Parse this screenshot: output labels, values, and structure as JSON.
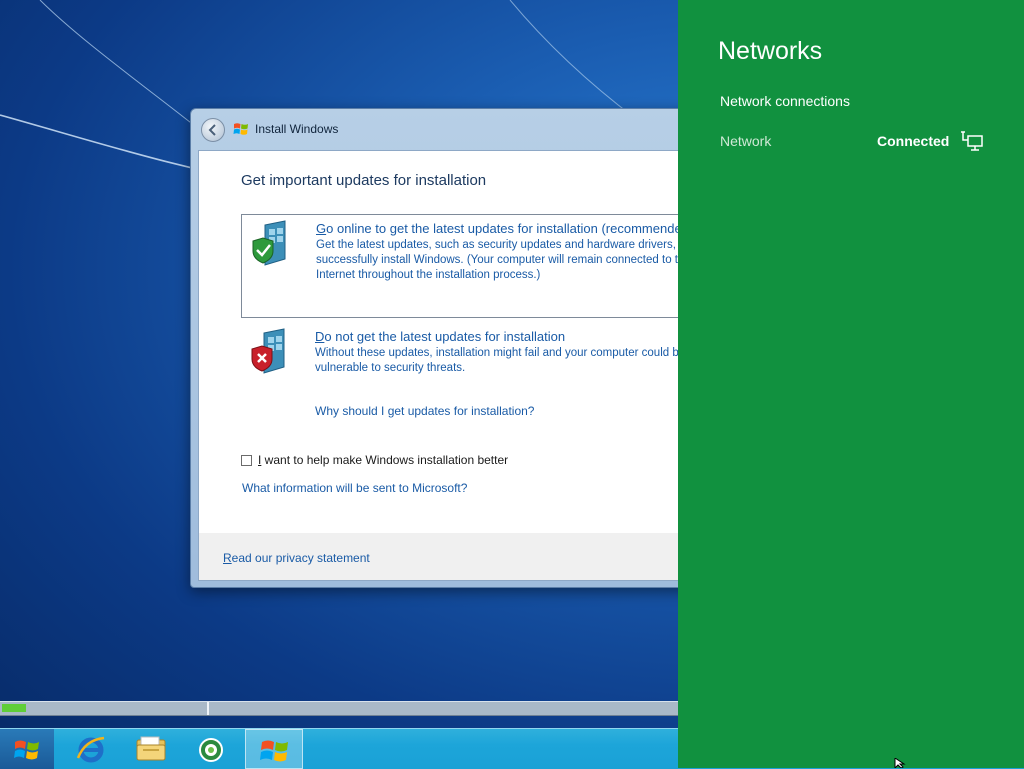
{
  "install_window": {
    "title": "Install Windows",
    "heading": "Get important updates for installation",
    "option_online": {
      "title_accel": "G",
      "title_rest": "o online to get the latest updates for installation (recommended)",
      "desc_lines": [
        "Get the latest updates, such as security updates and hardware drivers, to help",
        "successfully install Windows. (Your computer will remain connected to the",
        "Internet throughout the installation process.)"
      ]
    },
    "option_skip": {
      "title_accel": "D",
      "title_rest": "o not get the latest updates for installation",
      "desc_lines": [
        "Without these updates, installation might fail and your computer could be more",
        "vulnerable to security threats."
      ]
    },
    "why_link": "Why should I get updates for installation?",
    "help_checkbox_accel": "I",
    "help_checkbox_rest": " want to help make Windows installation better",
    "help_checkbox_checked": false,
    "info_link": "What information will be sent to Microsoft?",
    "privacy_accel": "R",
    "privacy_rest": "ead our privacy statement"
  },
  "progress": {
    "fraction": 0.035
  },
  "taskbar": {
    "items": [
      "start-orb-icon",
      "internet-explorer-icon",
      "file-explorer-icon",
      "media-center-icon",
      "windows-setup-icon"
    ]
  },
  "networks_panel": {
    "title": "Networks",
    "section_heading": "Network connections",
    "network_name": "Network",
    "network_status": "Connected",
    "status_icon": "wired-network-icon"
  },
  "colors": {
    "panel_green": "#11913f",
    "link_blue": "#1a5ba6",
    "taskbar": "#1da5d9",
    "progress_green": "#5fce38"
  }
}
